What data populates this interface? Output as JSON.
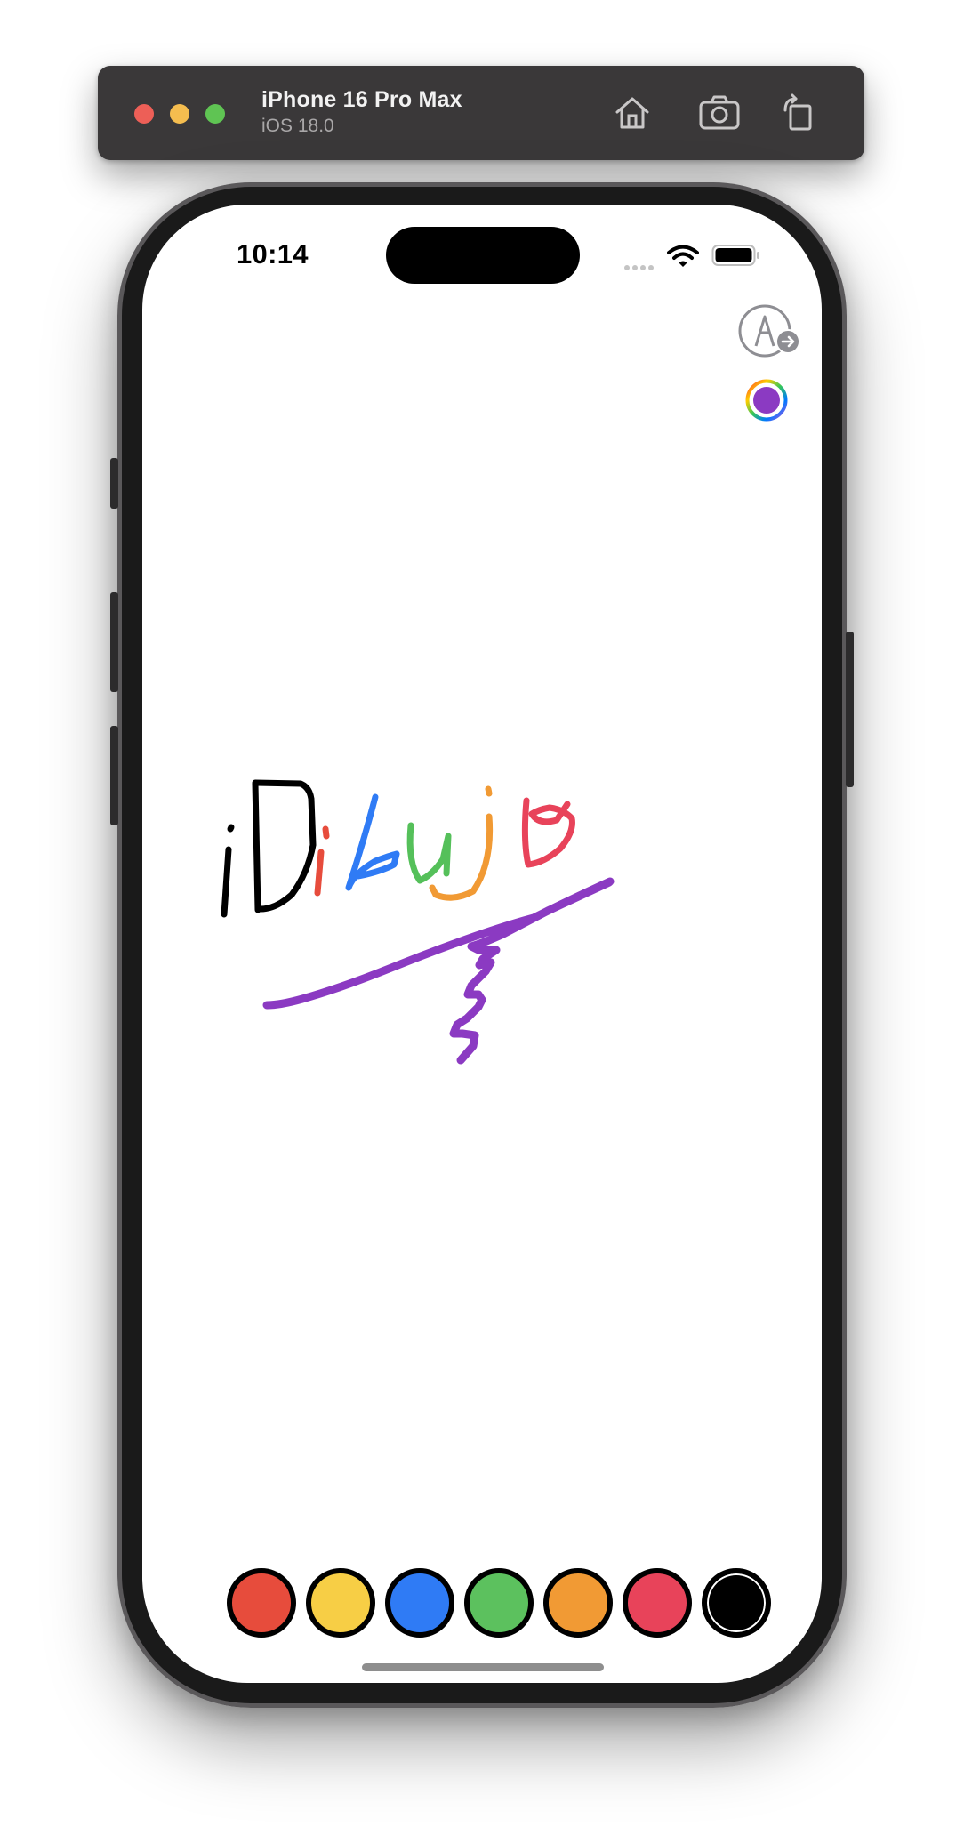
{
  "window": {
    "device_name": "iPhone 16 Pro Max",
    "os_version": "iOS 18.0",
    "buttons": [
      "home-icon",
      "screenshot-icon",
      "rotate-icon"
    ]
  },
  "status_bar": {
    "time": "10:14"
  },
  "toolbar": {
    "markup_icon": "markup-pen-icon",
    "color_picker_icon": "color-wheel-icon",
    "selected_color": "#8b3ac2"
  },
  "canvas": {
    "stroke_colors": {
      "exclamation": "#000000",
      "D": "#000000",
      "i": "#e74c3c",
      "b": "#2f7bf5",
      "u": "#55c05a",
      "j": "#f19a34",
      "o": "#e8435a",
      "underline": "#8b3ac2"
    }
  },
  "palette": {
    "colors": [
      {
        "name": "red",
        "hex": "#e74c3c"
      },
      {
        "name": "yellow",
        "hex": "#f7ce45"
      },
      {
        "name": "blue",
        "hex": "#2f7bf5"
      },
      {
        "name": "green",
        "hex": "#5cc15e"
      },
      {
        "name": "orange",
        "hex": "#f19a34"
      },
      {
        "name": "pink",
        "hex": "#e8435a"
      },
      {
        "name": "black",
        "hex": "#000000"
      }
    ]
  }
}
